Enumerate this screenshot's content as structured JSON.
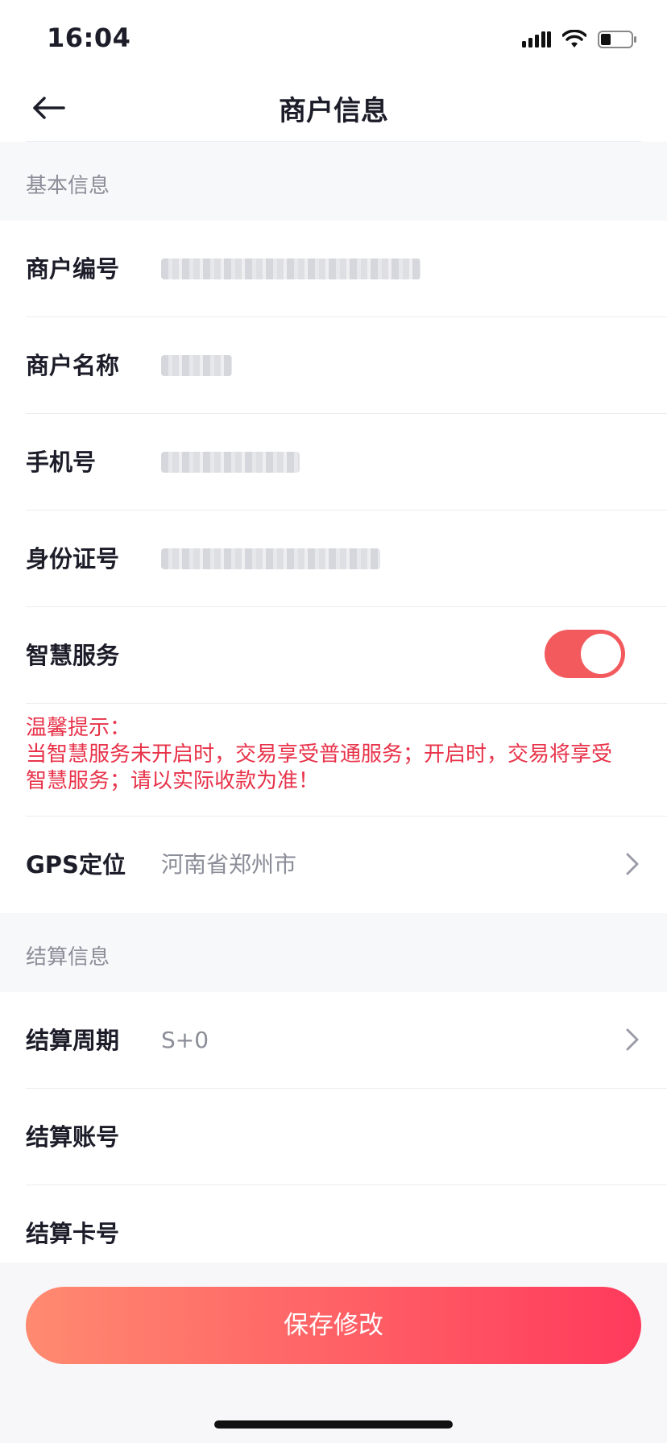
{
  "status_bar": {
    "time": "16:04"
  },
  "nav": {
    "title": "商户信息"
  },
  "sections": {
    "basic": "基本信息",
    "settlement": "结算信息"
  },
  "rows": {
    "merchant_no": {
      "label": "商户编号"
    },
    "merchant_name": {
      "label": "商户名称"
    },
    "phone": {
      "label": "手机号"
    },
    "id_no": {
      "label": "身份证号"
    },
    "smart_service": {
      "label": "智慧服务",
      "enabled": true
    },
    "gps": {
      "label": "GPS定位",
      "value": "河南省郑州市"
    },
    "settle_cycle": {
      "label": "结算周期",
      "value": "S+0"
    },
    "settle_account": {
      "label": "结算账号"
    },
    "settle_card": {
      "label": "结算卡号"
    }
  },
  "tip": {
    "line1": "温馨提示：",
    "line2": "当智慧服务未开启时，交易享受普通服务；开启时，交易将享受",
    "line3": "智慧服务；请以实际收款为准！"
  },
  "save_button": "保存修改",
  "colors": {
    "accent": "#f25a5e",
    "tip": "#e8334a",
    "button_start": "#ff8a70",
    "button_end": "#ff3a5c"
  }
}
